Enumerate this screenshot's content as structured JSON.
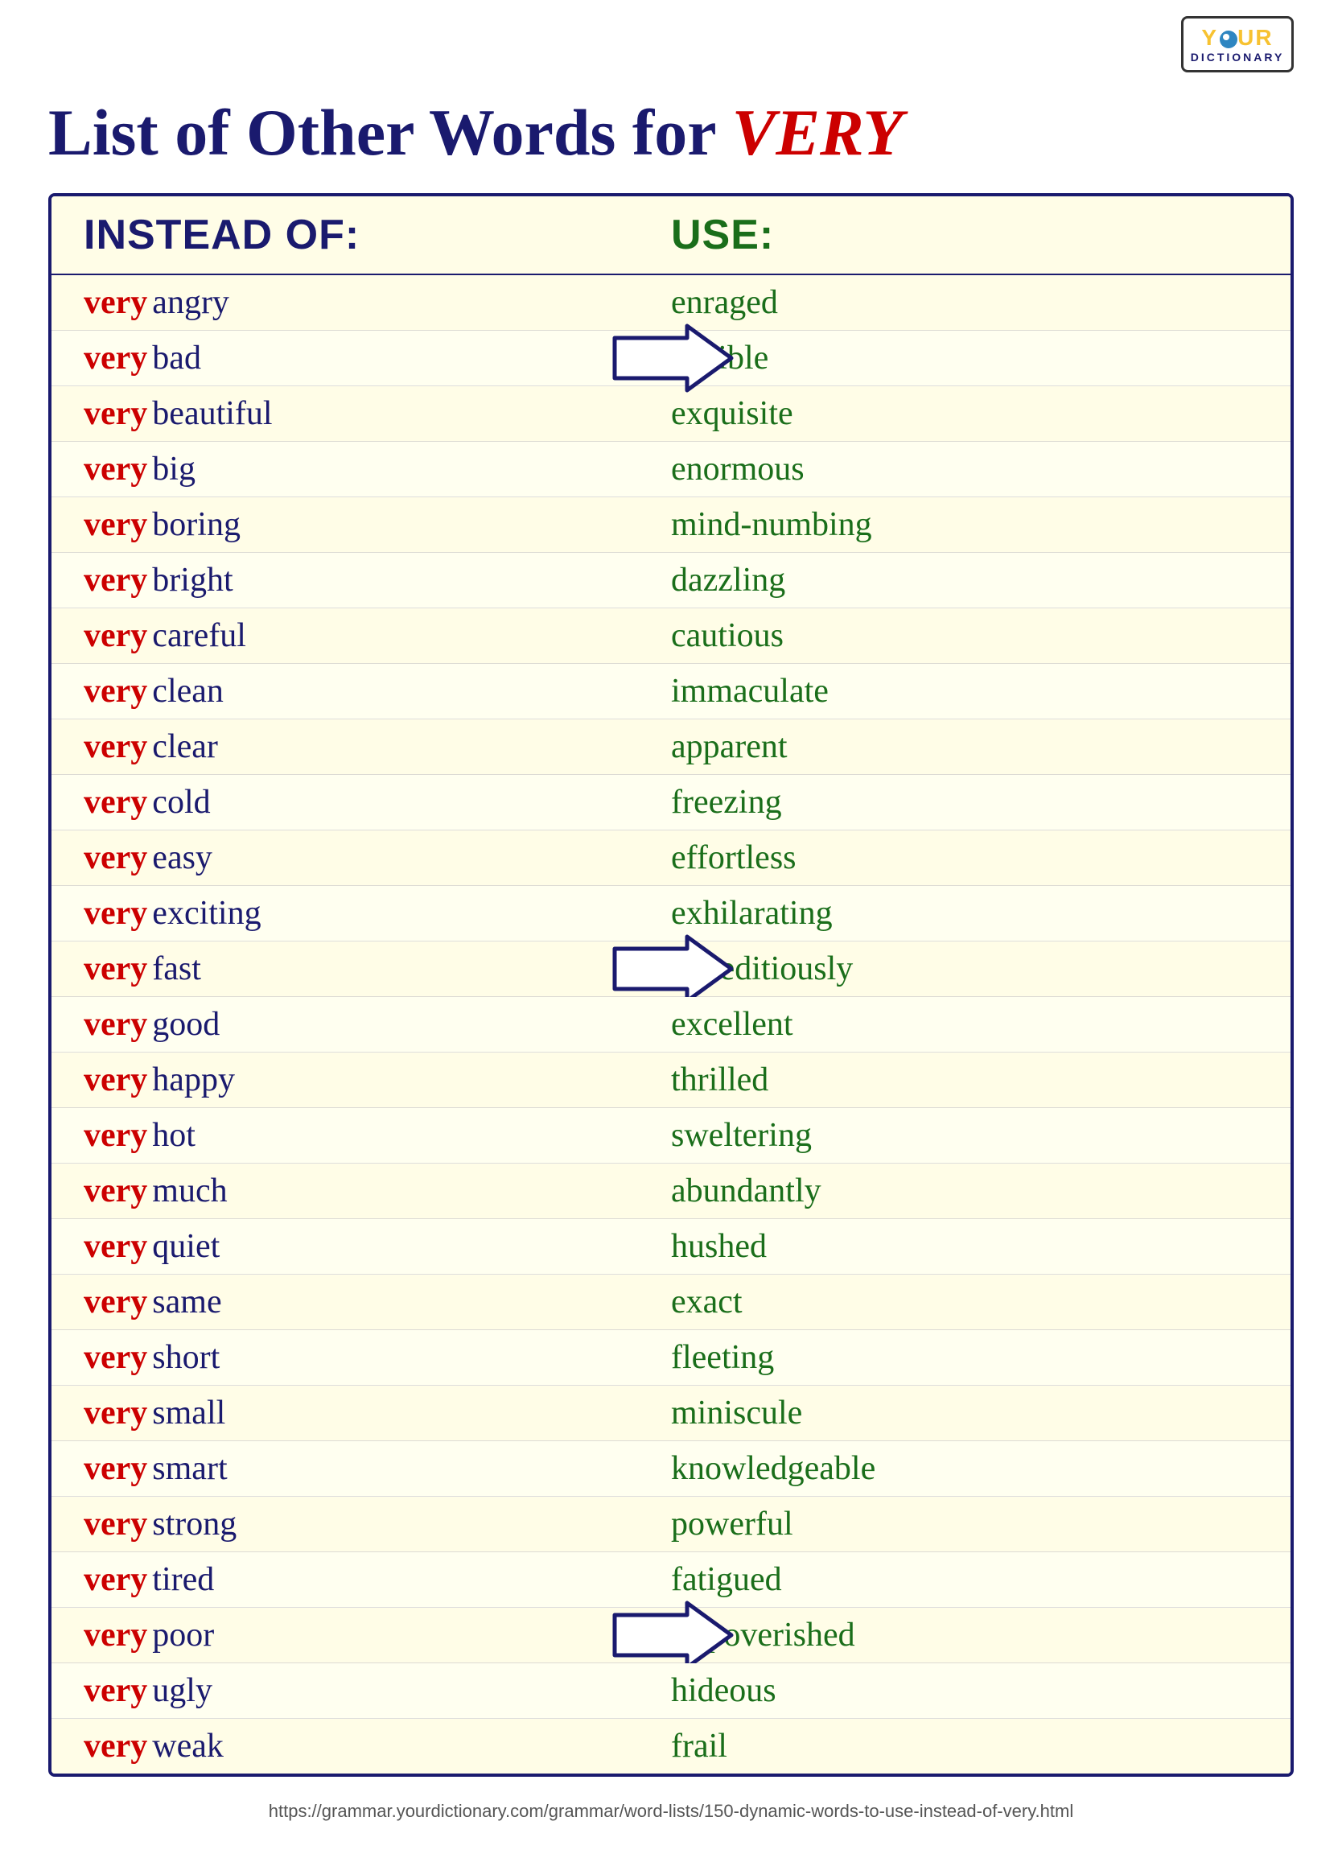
{
  "logo": {
    "your": "YOUR",
    "dictionary": "DICTIONARY"
  },
  "title": {
    "prefix": "List of Other Words for ",
    "very": "VERY"
  },
  "header": {
    "instead": "INSTEAD OF:",
    "use": "USE:"
  },
  "rows": [
    {
      "very": "very",
      "adj": "angry",
      "use": "enraged",
      "arrow": false
    },
    {
      "very": "very",
      "adj": "bad",
      "use": "terrible",
      "arrow": true
    },
    {
      "very": "very",
      "adj": "beautiful",
      "use": "exquisite",
      "arrow": false
    },
    {
      "very": "very",
      "adj": "big",
      "use": "enormous",
      "arrow": false
    },
    {
      "very": "very",
      "adj": "boring",
      "use": "mind-numbing",
      "arrow": false
    },
    {
      "very": "very",
      "adj": "bright",
      "use": "dazzling",
      "arrow": false
    },
    {
      "very": "very",
      "adj": "careful",
      "use": "cautious",
      "arrow": false
    },
    {
      "very": "very",
      "adj": "clean",
      "use": "immaculate",
      "arrow": false
    },
    {
      "very": "very",
      "adj": "clear",
      "use": "apparent",
      "arrow": false
    },
    {
      "very": "very",
      "adj": "cold",
      "use": "freezing",
      "arrow": false
    },
    {
      "very": "very",
      "adj": "easy",
      "use": "effortless",
      "arrow": false
    },
    {
      "very": "very",
      "adj": "exciting",
      "use": "exhilarating",
      "arrow": false
    },
    {
      "very": "very",
      "adj": "fast",
      "use": "expeditiously",
      "arrow": true
    },
    {
      "very": "very",
      "adj": "good",
      "use": "excellent",
      "arrow": false
    },
    {
      "very": "very",
      "adj": "happy",
      "use": "thrilled",
      "arrow": false
    },
    {
      "very": "very",
      "adj": "hot",
      "use": "sweltering",
      "arrow": false
    },
    {
      "very": "very",
      "adj": "much",
      "use": "abundantly",
      "arrow": false
    },
    {
      "very": "very",
      "adj": "quiet",
      "use": "hushed",
      "arrow": false
    },
    {
      "very": "very",
      "adj": "same",
      "use": "exact",
      "arrow": false
    },
    {
      "very": "very",
      "adj": "short",
      "use": "fleeting",
      "arrow": false
    },
    {
      "very": "very",
      "adj": "small",
      "use": "miniscule",
      "arrow": false
    },
    {
      "very": "very",
      "adj": "smart",
      "use": "knowledgeable",
      "arrow": false
    },
    {
      "very": "very",
      "adj": "strong",
      "use": "powerful",
      "arrow": false
    },
    {
      "very": "very",
      "adj": "tired",
      "use": "fatigued",
      "arrow": false
    },
    {
      "very": "very",
      "adj": "poor",
      "use": "impoverished",
      "arrow": true
    },
    {
      "very": "very",
      "adj": "ugly",
      "use": "hideous",
      "arrow": false
    },
    {
      "very": "very",
      "adj": "weak",
      "use": "frail",
      "arrow": false
    }
  ],
  "footer": {
    "url": "https://grammar.yourdictionary.com/grammar/word-lists/150-dynamic-words-to-use-instead-of-very.html"
  }
}
